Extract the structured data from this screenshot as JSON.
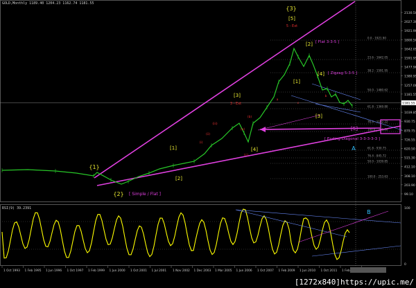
{
  "header": {
    "symbol": "GOLD,Monthly",
    "ohlc": "1189.40 1204.23 1162.74 1181.55"
  },
  "rsi_label": "RSI(9) 39.2391",
  "price_axis": {
    "ticks": [
      "2130.50",
      "2027.30",
      "1921.90",
      "1800.50",
      "1642.05",
      "1591.95",
      "1477.90",
      "1380.95",
      "1257.00",
      "1181.55",
      "1130.70",
      "1039.85",
      "930.75",
      "879.75",
      "726.55",
      "620.50",
      "515.30",
      "412.10",
      "308.10",
      "203.90",
      "99.10"
    ],
    "current": "1181.55"
  },
  "rsi_axis": {
    "ticks": [
      "100",
      "0"
    ]
  },
  "time_axis": {
    "ticks": [
      "1 Oct 1993",
      "1 Feb 1995",
      "1 Jun 1996",
      "1 Oct 1997",
      "1 Feb 1999",
      "1 Jun 2000",
      "1 Oct 2001",
      "1 Jul 2001",
      "1 Nov 2002",
      "1 Dec 2003",
      "1 Mar 2005",
      "1 Jun 2006",
      "1 Oct 2007",
      "1 Feb 2009",
      "1 Jun 2010",
      "1 Oct 2011",
      "1 Feb 2013",
      "1 Jun 2014"
    ]
  },
  "fib_labels": [
    "0.0 - 1921.90",
    "23.6 - 1642.05",
    "38.2 - 1591.95",
    "50.0 - 1480.62",
    "61.8 - 1369.80",
    "76.4 - 1192.22",
    "100.0 - 700.00",
    "50.0 - 1039.85",
    "61.8 - 930.75",
    "76.4 - 845.72",
    "100.0 - 253.63"
  ],
  "waves": {
    "w3_top": "{3}",
    "w5": "[5]",
    "w5_small": "5 - Ext",
    "flat_2": "[2]",
    "flat_label": "[ Flat 3-3-5 ]",
    "w4_big": "[4]",
    "zigzag_label": "[ Zigzag 5-3-5 ]",
    "w1b": "[1]",
    "w3b": "[3]",
    "w3_red": "3 - Ext",
    "w3c": "[3]",
    "w5c": "[5]",
    "w4c": "[4]",
    "ending_label": "[ Ending Diagonal 3-3-3-3-3 ]",
    "w1a": "[1]",
    "w2a": "[2]",
    "wave1": "{1}",
    "wave2": "{2}",
    "simple_flat": "[ Simple / Flat ]",
    "alpha": "A",
    "beta": "B"
  },
  "footer": {
    "watermark": "[1272x840]https://upic.me/"
  },
  "colors": {
    "price_line": "#28c828",
    "trend": "#e040e0",
    "rsi": "#ffff00",
    "wave_yellow": "#e8e832",
    "wave_red": "#e83030",
    "wave_cyan": "#30c0ff"
  }
}
